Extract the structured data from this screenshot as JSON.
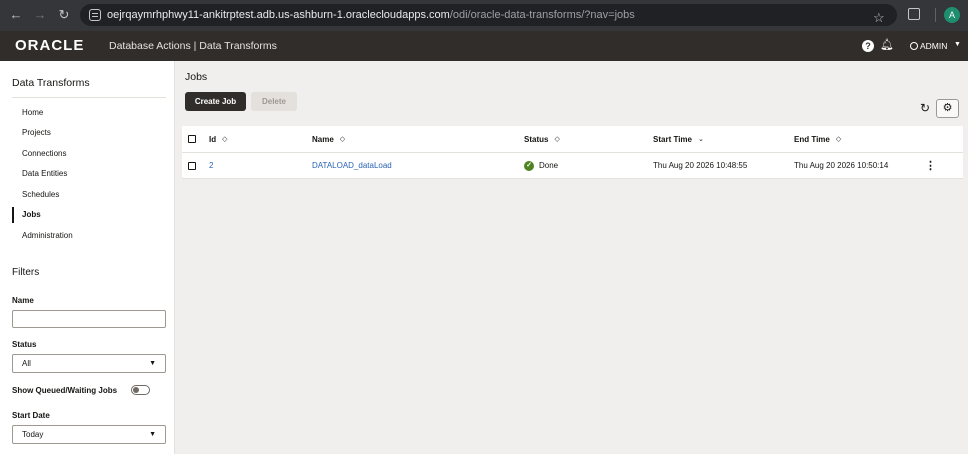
{
  "browser": {
    "back_icon": "arrow-left-icon",
    "forward_icon": "arrow-right-icon",
    "reload_icon": "reload-icon",
    "url_host": "oejrqaymrhphwy11-ankitrptest.adb.us-ashburn-1.oraclecloudapps.com",
    "url_path": "/odi/oracle-data-transforms/?nav=jobs",
    "profile_initial": "A"
  },
  "header": {
    "logo": "ORACLE",
    "title": "Database Actions | Data Transforms",
    "help_glyph": "?",
    "user": "ADMIN"
  },
  "sidebar": {
    "title": "Data Transforms",
    "items": [
      {
        "label": "Home",
        "active": false
      },
      {
        "label": "Projects",
        "active": false
      },
      {
        "label": "Connections",
        "active": false
      },
      {
        "label": "Data Entities",
        "active": false
      },
      {
        "label": "Schedules",
        "active": false
      },
      {
        "label": "Jobs",
        "active": true
      },
      {
        "label": "Administration",
        "active": false
      }
    ],
    "filters": {
      "title": "Filters",
      "name_label": "Name",
      "name_value": "",
      "status_label": "Status",
      "status_value": "All",
      "queued_label": "Show Queued/Waiting Jobs",
      "queued_on": false,
      "start_date_label": "Start Date",
      "start_date_value": "Today"
    }
  },
  "main": {
    "title": "Jobs",
    "create_label": "Create Job",
    "delete_label": "Delete",
    "columns": [
      "Id",
      "Name",
      "Status",
      "Start Time",
      "End Time"
    ],
    "rows": [
      {
        "id": "2",
        "name": "DATALOAD_dataLoad",
        "status": "Done",
        "start_time": "Thu Aug 20 2026 10:48:55",
        "end_time": "Thu Aug 20 2026 10:50:14"
      }
    ]
  },
  "colors": {
    "header_bg": "#312d2a",
    "link": "#2b64b6",
    "done": "#508223",
    "page_bg": "#f1efed"
  }
}
